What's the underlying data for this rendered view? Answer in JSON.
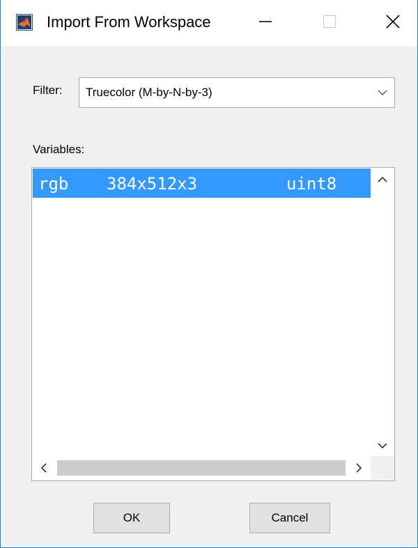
{
  "window": {
    "title": "Import From Workspace",
    "icon": "matlab-logo-icon",
    "controls": [
      "minimize-icon",
      "maximize-icon",
      "close-icon"
    ]
  },
  "filter": {
    "label": "Filter:",
    "selected": "Truecolor (M-by-N-by-3)"
  },
  "variables": {
    "label": "Variables:",
    "items": [
      {
        "name": "rgb",
        "size": "384x512x3",
        "class": "uint8",
        "selected": true
      }
    ]
  },
  "buttons": {
    "ok": "OK",
    "cancel": "Cancel"
  },
  "colors": {
    "selection": "#3399ff",
    "window_border": "#1883d7",
    "dialog_bg": "#f0f0f0"
  }
}
